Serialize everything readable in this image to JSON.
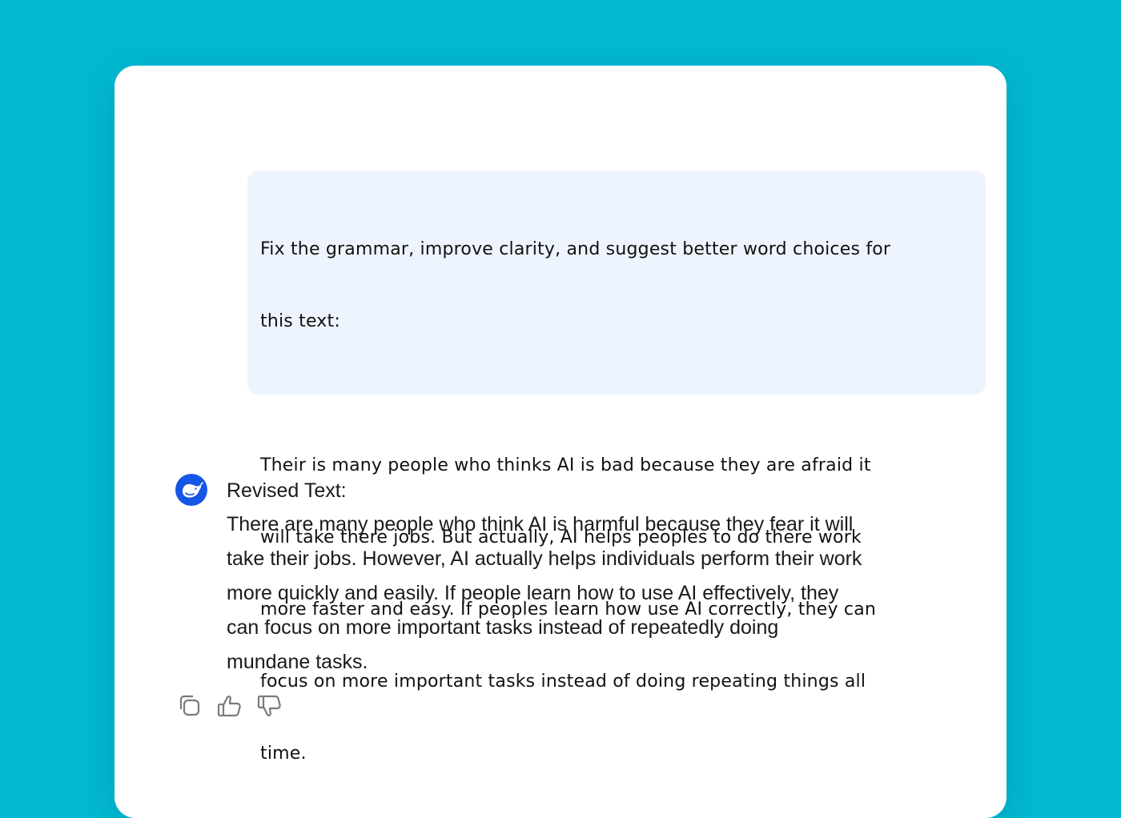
{
  "user_message": {
    "lines": [
      "Fix the grammar, improve clarity, and suggest better word choices for",
      "this text:",
      "",
      "Their is many people who thinks AI is bad because they are afraid it",
      "will take there jobs. But actually, AI helps peoples to do there work",
      "more faster and easy. If peoples learn how use AI correctly, they can",
      "focus on more important tasks instead of doing repeating things all",
      "time."
    ]
  },
  "assistant_message": {
    "avatar_icon": "whale-logo-icon",
    "heading": "Revised Text:",
    "lines": [
      "There are many people who think AI is harmful because they fear it will",
      "take their jobs. However, AI actually helps individuals perform their work",
      "more quickly and easily. If people learn how to use AI effectively, they",
      "can focus on more important tasks instead of repeatedly doing",
      "mundane tasks."
    ]
  },
  "actions": {
    "icons": [
      "copy-icon",
      "thumbs-up-icon",
      "thumbs-down-icon"
    ]
  },
  "colors": {
    "background": "#02b8d0",
    "card": "#ffffff",
    "user_bubble": "#eef4fd",
    "avatar": "#1656e6",
    "icon_stroke": "#7a7a7a"
  }
}
